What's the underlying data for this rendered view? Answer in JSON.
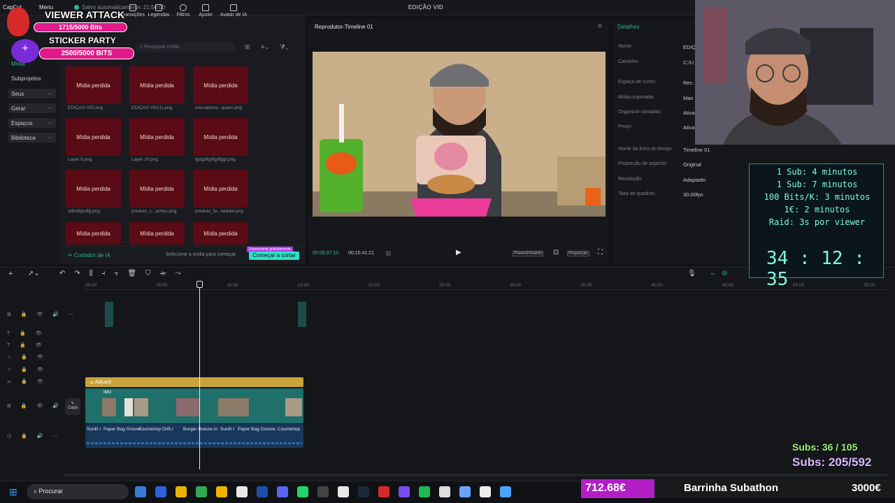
{
  "window": {
    "app_menu_1": "CapCut",
    "app_menu_2": "Menu",
    "title": "EDIÇÃO VID",
    "autosave": "Salvo automaticamente: 21:56:00"
  },
  "toolbar": {
    "items": [
      "Transições",
      "Legendas",
      "Filtros",
      "Ajuste",
      "Avatar de IA"
    ]
  },
  "sidebar": {
    "media": "Mídia",
    "subprojects": "Subprojetos",
    "items": [
      "Seus",
      "Gerar",
      "Espaços",
      "Biblioteca"
    ]
  },
  "media": {
    "search_placeholder": "Pesquisar mídia",
    "tile_label": "Mídia perdida",
    "files": [
      "EDIÇÃO VID.png",
      "EDIÇÃO VID(1).png",
      "mercadona...quare.png",
      "Layer 9.png",
      "Layer 10.png",
      "fgdgdfgdfgdfggf.png",
      "sdfsdfgsdfg.png",
      "produto_c...achos.png",
      "produto_fa...heddar.png",
      "",
      "",
      ""
    ],
    "ai_cutter": "Cortador de IA",
    "select_hint": "Selecione a mídia para começar",
    "free_badge": "Experimente gratuitamente",
    "start_button": "Começar a cortar"
  },
  "player": {
    "title": "Reprodutor-Timeline 01",
    "current_time": "00:08:07:15",
    "total_time": "00:15:41:21",
    "fill": "Preenchimento",
    "ratio": "Proporção"
  },
  "details": {
    "header": "Detalhes",
    "rows": [
      {
        "label": "Nome:",
        "value": "EDIÇ"
      },
      {
        "label": "Caminho:",
        "value": "C:/U"
      },
      {
        "label": "Espaço de cores:",
        "value": "Rec."
      },
      {
        "label": "Mídia importada:",
        "value": "Man"
      },
      {
        "label": "Organizar camadas",
        "value": "Ativa"
      },
      {
        "label": "Proxy:",
        "value": "Ativa"
      },
      {
        "label": "Nome da linha do tempo:",
        "value": "Timeline 01"
      },
      {
        "label": "Proporção de aspecto:",
        "value": "Original"
      },
      {
        "label": "Resolução:",
        "value": "Adaptado"
      },
      {
        "label": "Taxa de quadros:",
        "value": "30.00fps"
      }
    ]
  },
  "timeline": {
    "ruler": [
      "00:00",
      "05:00",
      "10:00",
      "15:00",
      "20:00",
      "25:00",
      "30:00",
      "35:00",
      "40:00",
      "45:00",
      "50:00",
      "55:00"
    ],
    "adjust_clip": "Adjust3",
    "cover_label": "Capa",
    "clip_names": [
      "Sunlit I",
      "Paper Bag Groove",
      "Countertop Drift.r",
      "Burger Breeze.m",
      "Sunlit I",
      "Paper Bag Groove",
      "Countertop"
    ],
    "img_label": "IMG"
  },
  "overlay": {
    "viewer_attack": "VIEWER ATTACK",
    "viewer_bits": "1715/5000 Bits",
    "sticker_party": "STICKER PARTY",
    "sticker_bits": "2500/5000 BITS",
    "timer_lines": [
      "1 Sub: 4 minutos",
      "1 Sub: 7 minutos",
      "100 Bits/K: 3 minutos",
      "1€: 2 minutos",
      "Raid: 3s por viewer"
    ],
    "timer_h": "34",
    "timer_m": "12",
    "timer_s": "35",
    "subs_1": "Subs: 36 / 105",
    "subs_2": "Subs: 205/592",
    "money": "712.68€",
    "bar_label": "Barrinha Subathon",
    "goal": "3000€"
  },
  "taskbar": {
    "search": "Procurar"
  },
  "colors": {
    "accent": "#2fb4a4",
    "tile": "#5a0b15",
    "clip_teal": "#1f6f6a",
    "adjust": "#c8a23a",
    "pink": "#e21a89",
    "neon": "#7cf9e0",
    "green_text": "#9ef07a"
  }
}
